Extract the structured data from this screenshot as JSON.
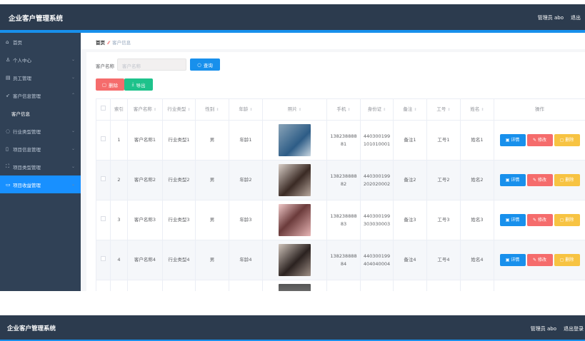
{
  "app": {
    "title": "企业客户管理系统",
    "user": "管理员 abo",
    "logout": "退出",
    "logout_full": "退出登录"
  },
  "sidebar": {
    "items": [
      {
        "label": "首页",
        "icon": "home-icon",
        "chev": ""
      },
      {
        "label": "个人中心",
        "icon": "user-icon",
        "chev": "⌄"
      },
      {
        "label": "员工管理",
        "icon": "list-icon",
        "chev": "⌄"
      },
      {
        "label": "客户信息管理",
        "icon": "send-icon",
        "chev": "⌃"
      },
      {
        "label": "客户信息",
        "icon": "",
        "chev": "",
        "sub": true
      },
      {
        "label": "行业类型管理",
        "icon": "power-icon",
        "chev": "⌄"
      },
      {
        "label": "项目信息管理",
        "icon": "phone-icon",
        "chev": "⌄"
      },
      {
        "label": "项目类型管理",
        "icon": "frame-icon",
        "chev": "⌄"
      },
      {
        "label": "项目收益管理",
        "icon": "crop-icon",
        "chev": "⌄",
        "active": true
      }
    ]
  },
  "breadcrumb": {
    "home": "首页",
    "current": "客户信息"
  },
  "search": {
    "label": "客户名称",
    "placeholder": "客户名称",
    "button": "查询"
  },
  "toolbar": {
    "delete": "删除",
    "export": "导出"
  },
  "colors": {
    "header": "#2c3b4e",
    "accent": "#1890ff",
    "danger": "#f56c6c",
    "success": "#1ec28b",
    "warning": "#f7c342"
  },
  "table": {
    "headers": [
      "索引",
      "客户名称",
      "行业类型",
      "性别",
      "年龄",
      "照片",
      "手机",
      "身份证",
      "备注",
      "工号",
      "姓名",
      "操作"
    ],
    "actions": {
      "detail": "详情",
      "edit": "修改",
      "delete": "删除"
    },
    "rows": [
      {
        "idx": "1",
        "name": "客户名称1",
        "type": "行业类型1",
        "sex": "男",
        "age": "年龄1",
        "phone": "13823888881",
        "id": "440300199101010001",
        "note": "备注1",
        "no": "工号1",
        "xm": "姓名1"
      },
      {
        "idx": "2",
        "name": "客户名称2",
        "type": "行业类型2",
        "sex": "男",
        "age": "年龄2",
        "phone": "13823888882",
        "id": "440300199202020002",
        "note": "备注2",
        "no": "工号2",
        "xm": "姓名2"
      },
      {
        "idx": "3",
        "name": "客户名称3",
        "type": "行业类型3",
        "sex": "男",
        "age": "年龄3",
        "phone": "13823888883",
        "id": "440300199303030003",
        "note": "备注3",
        "no": "工号3",
        "xm": "姓名3"
      },
      {
        "idx": "4",
        "name": "客户名称4",
        "type": "行业类型4",
        "sex": "男",
        "age": "年龄4",
        "phone": "13823888884",
        "id": "440300199404040004",
        "note": "备注4",
        "no": "工号4",
        "xm": "姓名4"
      }
    ]
  }
}
